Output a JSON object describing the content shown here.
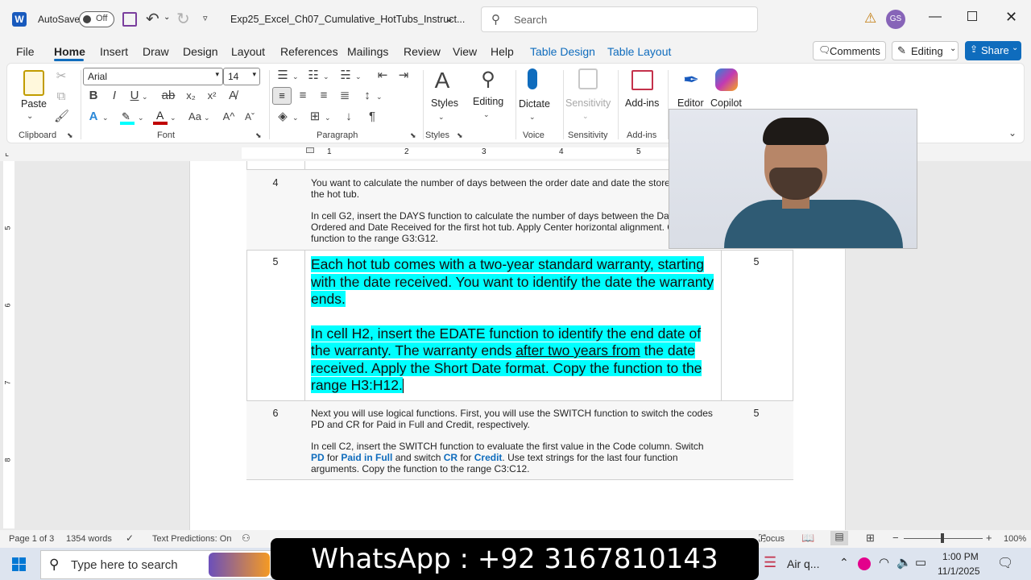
{
  "titlebar": {
    "autosave_label": "AutoSave",
    "autosave_state": "Off",
    "doc_title": "Exp25_Excel_Ch07_Cumulative_HotTubs_Instruct...",
    "search_placeholder": "Search",
    "user_initials": "GS"
  },
  "menu": {
    "items": [
      "File",
      "Home",
      "Insert",
      "Draw",
      "Design",
      "Layout",
      "References",
      "Mailings",
      "Review",
      "View",
      "Help",
      "Table Design",
      "Table Layout"
    ],
    "comments_label": "Comments",
    "editing_label": "Editing",
    "share_label": "Share"
  },
  "ribbon": {
    "paste_label": "Paste",
    "font_name": "Arial",
    "font_size": "14",
    "styles_label": "Styles",
    "editing_label": "Editing",
    "dictate_label": "Dictate",
    "sensitivity_label": "Sensitivity",
    "addins_label": "Add-ins",
    "editor_label": "Editor",
    "copilot_label": "Copilot",
    "groups": {
      "clipboard": "Clipboard",
      "font": "Font",
      "paragraph": "Paragraph",
      "styles": "Styles",
      "voice": "Voice",
      "sensitivity": "Sensitivity",
      "addins": "Add-ins"
    },
    "bold": "B",
    "italic": "I",
    "underline": "U",
    "strike": "ab",
    "subscript": "x₂",
    "superscript": "x²"
  },
  "ruler": {
    "ticks": [
      "1",
      "2",
      "3",
      "4",
      "5"
    ],
    "vticks": [
      "5",
      "6",
      "7",
      "8"
    ]
  },
  "table": {
    "rows": [
      {
        "num": "4",
        "p1": "You want to calculate the number of days between the order date and date the store received",
        "p1b": "the hot tub.",
        "p2a": "In cell G2, insert the DAYS function to calculate the number of days between the Date",
        "p2b": "Ordered and Date Received for the first hot tub. Apply Center horizontal alignment. Copy the",
        "p2c": "function to the range G3:G12."
      },
      {
        "num": "5",
        "points": "5",
        "big1": "Each hot tub comes with a two-year standard warranty, starting with the date received. You want to identify the date the warranty ends.",
        "big2a": "In cell H2, insert the EDATE function to identify the end date of the warranty. The warranty ends ",
        "big2u": "after two years from",
        "big2b": " the date received. Apply the Short Date format. Copy the function to the range H3:H12."
      },
      {
        "num": "6",
        "points": "5",
        "p1a": "Next you will use logical functions. First, you will use the SWITCH function to switch the codes",
        "p1b": "PD and CR for Paid in Full and Credit, respectively.",
        "p2a": "In cell C2, insert the SWITCH function to evaluate the first value in the Code column. Switch",
        "pd": "PD",
        "for1": " for ",
        "paid": "Paid in Full",
        "and": " and switch ",
        "cr": "CR",
        "for2": " for ",
        "credit": "Credit",
        "p2rest": ". Use text strings for the last four function",
        "p2c": "arguments. Copy the function to the range C3:C12."
      }
    ]
  },
  "status": {
    "page": "Page 1 of 3",
    "words": "1354 words",
    "predictions": "Text Predictions: On",
    "focus": "Focus",
    "zoom": "100%"
  },
  "taskbar": {
    "search_placeholder": "Type here to search",
    "overlay": "WhatsApp : +92 3167810143",
    "air_quality": "Air q...",
    "time": "1:00 PM",
    "date": "11/1/2025"
  },
  "colors": {
    "accent": "#0f6cbd",
    "highlight": "#00ffff",
    "share_bg": "#0f6cbd"
  }
}
